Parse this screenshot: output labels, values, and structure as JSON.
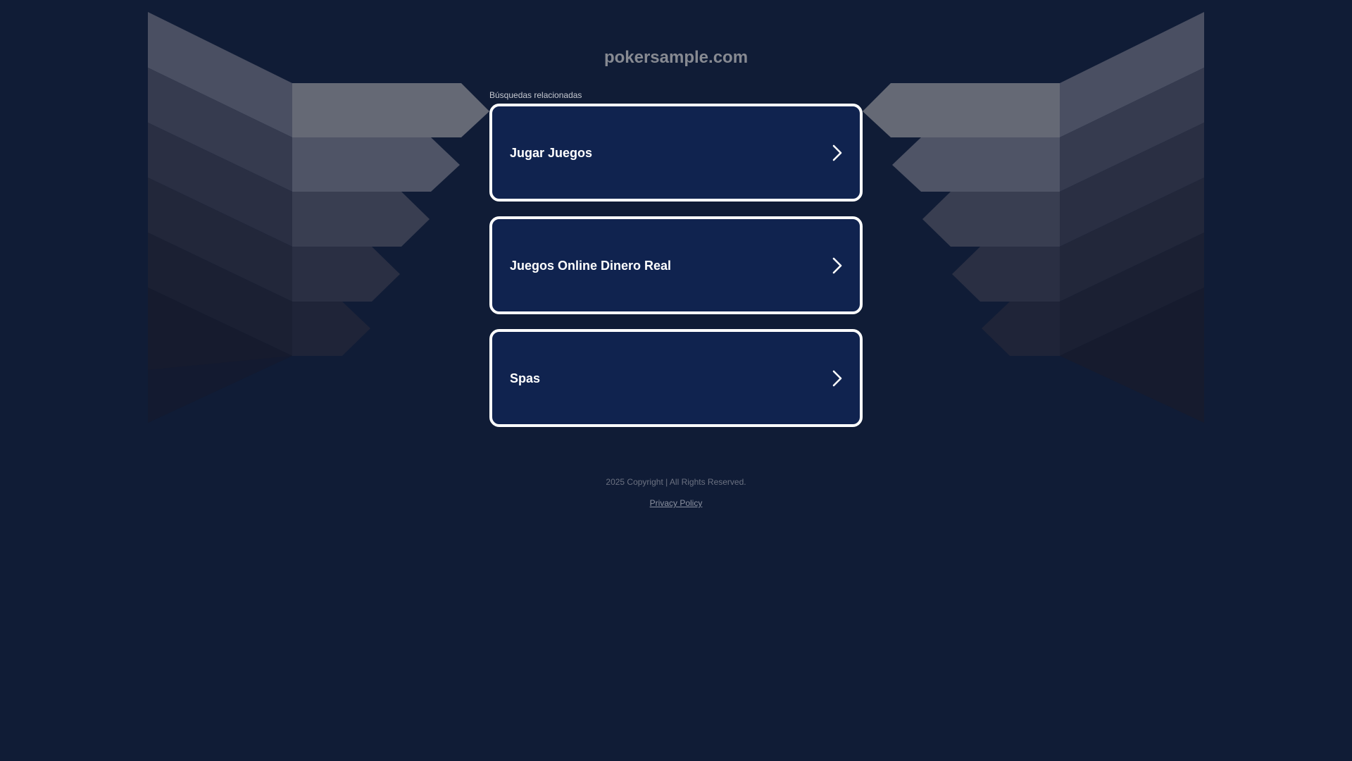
{
  "site": {
    "domain": "pokersample.com"
  },
  "related": {
    "label": "Búsquedas relacionadas",
    "links": [
      {
        "label": "Jugar Juegos",
        "icon": "chevron-right-icon"
      },
      {
        "label": "Juegos Online Dinero Real",
        "icon": "chevron-right-icon"
      },
      {
        "label": "Spas",
        "icon": "chevron-right-icon"
      }
    ]
  },
  "footer": {
    "copyright": "2025 Copyright | All Rights Reserved.",
    "privacy": "Privacy Policy"
  },
  "colors": {
    "background": "#101c36",
    "card_fill": "#10234f",
    "card_border": "#ffffff",
    "title": "#878a92"
  }
}
